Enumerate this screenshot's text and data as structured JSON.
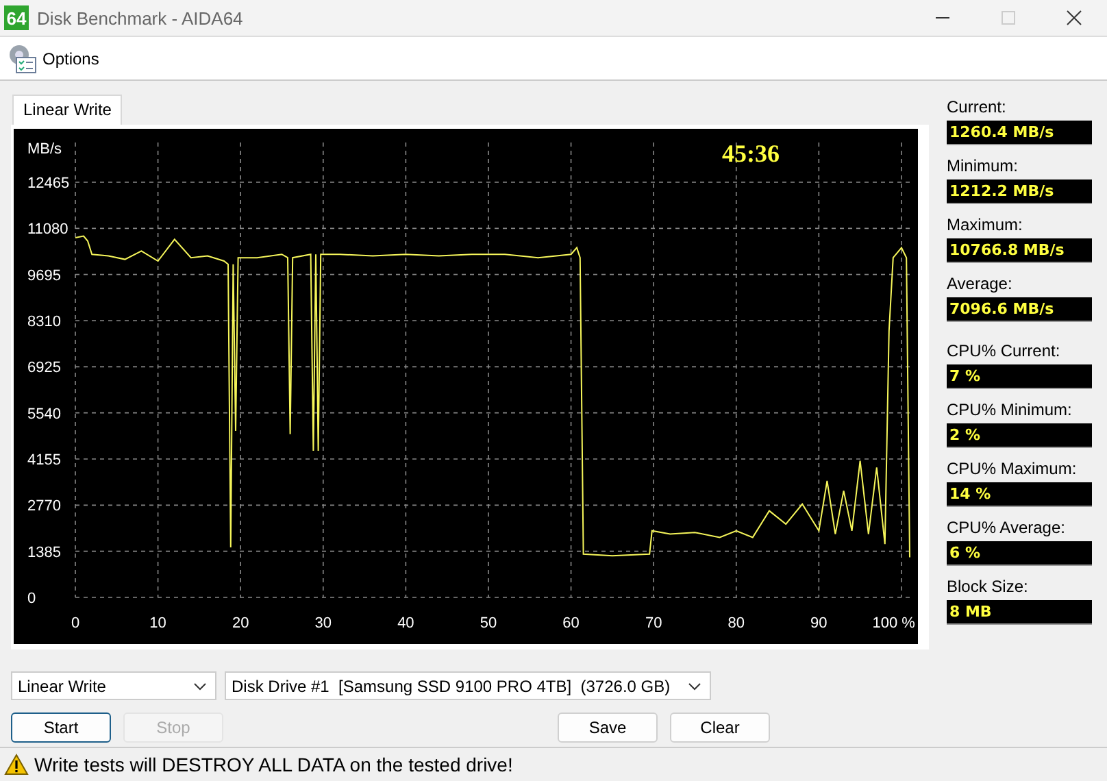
{
  "window": {
    "title": "Disk Benchmark - AIDA64",
    "app_icon": "64"
  },
  "toolbar": {
    "options_label": "Options"
  },
  "tabs": [
    {
      "label": "Linear Write",
      "selected": true
    }
  ],
  "chart": {
    "elapsed": "45:36",
    "chart_data": {
      "type": "line",
      "grid": true,
      "ylabel": "MB/s",
      "xlim": [
        0,
        101
      ],
      "ylim": [
        0,
        12465
      ],
      "yticks": [
        0,
        1385,
        2770,
        4155,
        5540,
        6925,
        8310,
        9695,
        11080,
        12465
      ],
      "xticks": [
        0,
        10,
        20,
        30,
        40,
        50,
        60,
        70,
        80,
        90,
        {
          "value": 100,
          "label": "100 %"
        }
      ],
      "x": [
        0,
        1,
        1.5,
        2,
        4,
        6,
        8,
        10,
        12,
        14,
        16,
        18,
        18.5,
        18.8,
        19.1,
        19.4,
        19.7,
        22,
        25,
        25.7,
        26,
        26.3,
        28.5,
        28.8,
        29.1,
        29.4,
        29.7,
        32,
        36,
        40,
        44,
        48,
        52,
        56,
        60,
        60.7,
        61.1,
        61.5,
        65,
        69.5,
        69.8,
        72,
        75,
        78,
        80,
        82,
        84,
        86,
        88,
        90,
        91,
        92,
        93,
        94,
        95,
        96,
        97,
        98,
        98.5,
        99,
        100,
        100.6,
        101
      ],
      "series": [
        {
          "color": "#f5f55a",
          "values": [
            10800,
            10850,
            10700,
            10300,
            10250,
            10150,
            10400,
            10100,
            10750,
            10200,
            10250,
            10100,
            10000,
            1500,
            10000,
            5000,
            10200,
            10200,
            10300,
            10200,
            4900,
            10200,
            10300,
            4400,
            10300,
            4400,
            10300,
            10300,
            10250,
            10300,
            10250,
            10300,
            10300,
            10200,
            10300,
            10500,
            10200,
            1300,
            1250,
            1300,
            2000,
            1900,
            1950,
            1800,
            2000,
            1800,
            2600,
            2200,
            2800,
            2000,
            3500,
            1900,
            3200,
            2000,
            4100,
            1900,
            3900,
            1600,
            8000,
            10200,
            10500,
            10200,
            1200
          ]
        }
      ]
    }
  },
  "stat_groups": [
    [
      {
        "label": "Current:",
        "value": "1260.4 MB/s"
      },
      {
        "label": "Minimum:",
        "value": "1212.2 MB/s"
      },
      {
        "label": "Maximum:",
        "value": "10766.8 MB/s"
      },
      {
        "label": "Average:",
        "value": "7096.6 MB/s"
      }
    ],
    [
      {
        "label": "CPU% Current:",
        "value": "7 %"
      },
      {
        "label": "CPU% Minimum:",
        "value": "2 %"
      },
      {
        "label": "CPU% Maximum:",
        "value": "14 %"
      },
      {
        "label": "CPU% Average:",
        "value": "6 %"
      },
      {
        "label": "Block Size:",
        "value": "8 MB"
      }
    ]
  ],
  "selects": [
    {
      "kind": "test",
      "value": "Linear Write"
    },
    {
      "kind": "drive",
      "value": "Disk Drive #1  [Samsung SSD 9100 PRO 4TB]  (3726.0 GB)"
    }
  ],
  "buttons": [
    {
      "label": "Start",
      "disabled": false,
      "focused": true
    },
    {
      "label": "Stop",
      "disabled": true,
      "focused": false
    },
    {
      "label": "Save",
      "disabled": false,
      "focused": false
    },
    {
      "label": "Clear",
      "disabled": false,
      "focused": false
    }
  ],
  "status_bar": {
    "message": "Write tests will DESTROY ALL DATA on the tested drive!"
  }
}
